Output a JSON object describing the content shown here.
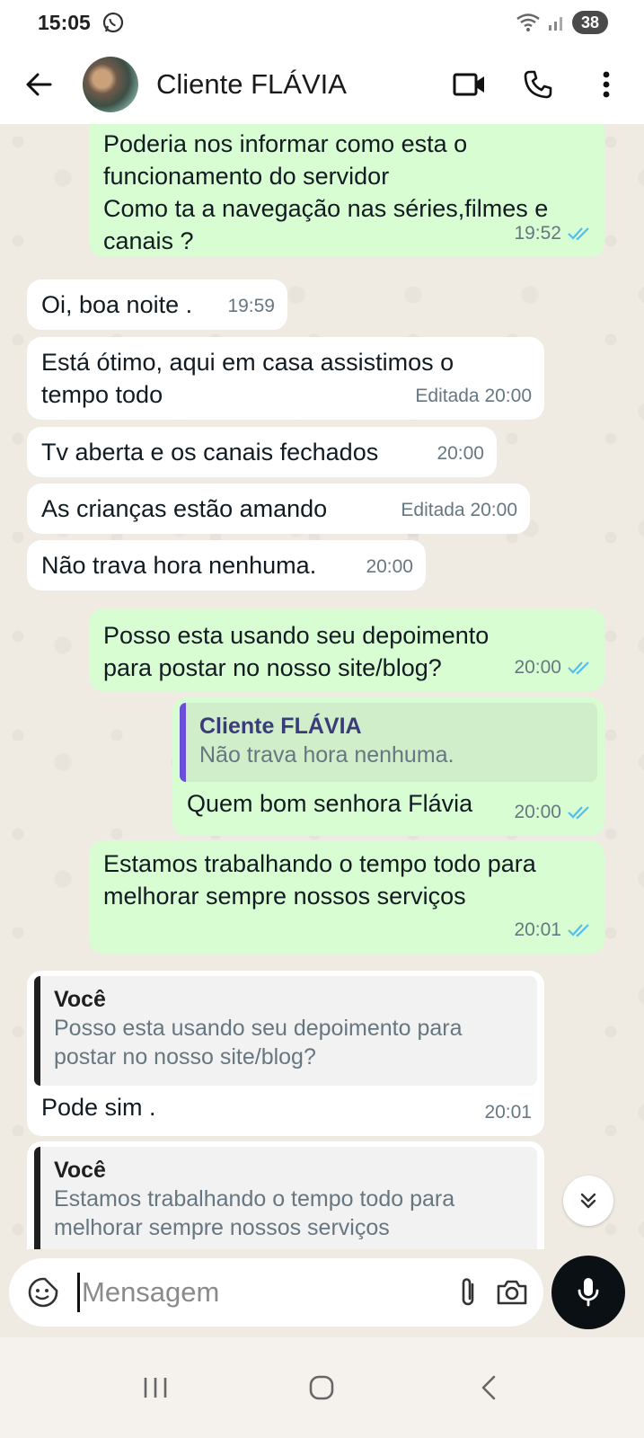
{
  "status_bar": {
    "time": "15:05",
    "battery": "38"
  },
  "header": {
    "contact_name": "Cliente FLÁVIA"
  },
  "messages": [
    {
      "dir": "out",
      "text": "Poderia nos informar como esta o funcionamento do servidor\nComo ta a navegação nas séries,filmes e canais ?",
      "time": "19:52",
      "read": true
    },
    {
      "dir": "in",
      "text": "Oi, boa noite .",
      "time": "19:59"
    },
    {
      "dir": "in",
      "text": "Está ótimo, aqui em casa assistimos  o tempo todo",
      "time": "Editada 20:00"
    },
    {
      "dir": "in",
      "text": "Tv aberta e os canais fechados",
      "time": "20:00"
    },
    {
      "dir": "in",
      "text": "As crianças estão  amando",
      "time": "Editada 20:00"
    },
    {
      "dir": "in",
      "text": "Não trava hora nenhuma.",
      "time": "20:00"
    },
    {
      "dir": "out",
      "text": "Posso esta usando seu depoimento para postar no nosso site/blog?",
      "time": "20:00",
      "read": true
    },
    {
      "dir": "out",
      "quote_name": "Cliente FLÁVIA",
      "quote_text": "Não trava hora nenhuma.",
      "text": "Quem bom senhora Flávia",
      "time": "20:00",
      "read": true
    },
    {
      "dir": "out",
      "text": "Estamos trabalhando o tempo todo para melhorar sempre nossos serviços",
      "time": "20:01",
      "read": true
    },
    {
      "dir": "in",
      "quote_name": "Você",
      "quote_text": "Posso esta usando seu depoimento para postar no nosso site/blog?",
      "text": "Pode sim .",
      "time": "20:01"
    },
    {
      "dir": "in",
      "quote_name": "Você",
      "quote_text": "Estamos trabalhando o tempo todo para melhorar sempre nossos serviços",
      "text": "",
      "time": ""
    }
  ],
  "input": {
    "placeholder": "Mensagem"
  },
  "colors": {
    "outgoing_bubble": "#d9fdd3",
    "incoming_bubble": "#ffffff",
    "read_ticks": "#53bdeb",
    "chat_background": "#efeae2"
  },
  "icons": {
    "header": [
      "back-arrow-icon",
      "video-call-icon",
      "phone-icon",
      "more-vert-icon"
    ],
    "input": [
      "sticker-icon",
      "attach-icon",
      "camera-icon",
      "mic-icon"
    ],
    "nav": [
      "recents-icon",
      "home-icon",
      "back-icon"
    ]
  }
}
